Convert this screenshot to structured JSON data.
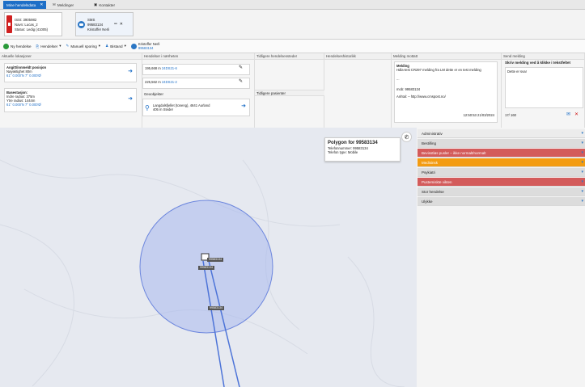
{
  "tabs": {
    "incidents": "Mine hendelsdata",
    "messages": "Meldinger",
    "contacts": "Kontakter"
  },
  "cards": {
    "caller": {
      "id": "ISSI: 3905982",
      "name": "Navn: Lucas_2",
      "status": "Status: Ledig (41005)"
    },
    "sms": {
      "type": "SMS",
      "number": "99583134",
      "person": "Kristoffer Nerli"
    }
  },
  "toolbar": {
    "new_incident": "Ny hendelse",
    "events": "Hendelser",
    "manual_tracking": "Manuell sporing",
    "assist": "Bistand",
    "contact_name": "Kristoffer Nerli",
    "contact_number": "99583134"
  },
  "panels": {
    "current_locations": {
      "header": "Aktuelle lokasjoner",
      "item1": {
        "title": "Angitt/innmeldt posisjon",
        "accuracy": "Nøyaktighet 80m",
        "coords": "61° 0.000'N 7° 0.000'Ø"
      },
      "item2": {
        "title": "Basestasjon:",
        "inner": "Indre radius: 375m",
        "outer": "Ytre radius: 1444m",
        "coords": "61° 0.000'N 7° 0.000'Ø"
      }
    },
    "nearby_incidents": {
      "header": "Hendelser i nærheten",
      "row1": {
        "distance": "195,668 m",
        "id": "24DS21-6"
      },
      "row2": {
        "distance": "225,562 m",
        "id": "24DS21-2"
      },
      "geo_header": "Geoobjekter",
      "geo_item": {
        "name": "Langdalsfjellet (toneng), 4641 Aurland",
        "distance": "405 m Steder"
      }
    },
    "previous_places": {
      "header": "Tidligere hendelsessteder",
      "patients_header": "Tidligere pasienter"
    },
    "incident_history": {
      "header": "Hendelseshistorikk"
    },
    "received_message": {
      "header": "Melding mottatt",
      "title": "Melding",
      "body": "Hdla-test CR297 melding fra LM dette er en test melding",
      "dots": "...",
      "mob": "mob: 99583134",
      "link": "Anhtal: – http://www.cmspost.no/",
      "time": "12:50:53 21/03/2024"
    },
    "send_message": {
      "header": "Send melding",
      "title": "Skriv melding ved å klikke i tekstfeltet",
      "text": "Dette er svar",
      "counter": "17/ 160"
    }
  },
  "popup": {
    "title": "Polygon for 99583134",
    "phone": "Telefonnummer: 99583134",
    "phone_type": "Telefon type: Mobile"
  },
  "map": {
    "marker_label_1": "99583134",
    "marker_label_2": "99583134",
    "marker_label_3": "99583134"
  },
  "categories": [
    {
      "label": "Administrativ",
      "color": "#ececec"
    },
    {
      "label": "Bestilling",
      "color": "#dcdcdc"
    },
    {
      "label": "Bevisstløs pusler – ikke normalt/normalt",
      "color": "#d35b5b"
    },
    {
      "label": "Medisinsk",
      "color": "#f39c12"
    },
    {
      "label": "Psykiatri",
      "color": "#dcdcdc"
    },
    {
      "label": "Pustemiskte vikten",
      "color": "#d35b5b"
    },
    {
      "label": "Stor hendelse",
      "color": "#dcdcdc"
    },
    {
      "label": "Ulykke",
      "color": "#dcdcdc"
    }
  ],
  "colors": {
    "accent": "#1e6fc7",
    "alarm": "#d35b5b",
    "warning": "#f39c12",
    "circle": "#a9b9ee"
  }
}
